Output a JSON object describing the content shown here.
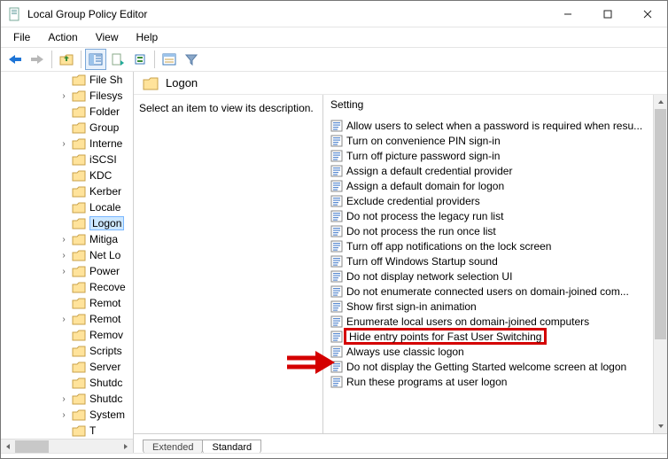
{
  "window": {
    "title": "Local Group Policy Editor"
  },
  "menu": {
    "file": "File",
    "action": "Action",
    "view": "View",
    "help": "Help"
  },
  "tree": {
    "items": [
      {
        "label": "File Sh",
        "expander": ""
      },
      {
        "label": "Filesys",
        "expander": "›"
      },
      {
        "label": "Folder",
        "expander": ""
      },
      {
        "label": "Group",
        "expander": ""
      },
      {
        "label": "Interne",
        "expander": "›"
      },
      {
        "label": "iSCSI",
        "expander": ""
      },
      {
        "label": "KDC",
        "expander": ""
      },
      {
        "label": "Kerber",
        "expander": ""
      },
      {
        "label": "Locale",
        "expander": ""
      },
      {
        "label": "Logon",
        "expander": "",
        "selected": true
      },
      {
        "label": "Mitiga",
        "expander": "›"
      },
      {
        "label": "Net Lo",
        "expander": "›"
      },
      {
        "label": "Power",
        "expander": "›"
      },
      {
        "label": "Recove",
        "expander": ""
      },
      {
        "label": "Remot",
        "expander": ""
      },
      {
        "label": "Remot",
        "expander": "›"
      },
      {
        "label": "Remov",
        "expander": ""
      },
      {
        "label": "Scripts",
        "expander": ""
      },
      {
        "label": "Server",
        "expander": ""
      },
      {
        "label": "Shutdc",
        "expander": ""
      },
      {
        "label": "Shutdc",
        "expander": "›"
      },
      {
        "label": "System",
        "expander": "›"
      },
      {
        "label": "T",
        "expander": ""
      }
    ]
  },
  "header": {
    "label": "Logon"
  },
  "description": {
    "prompt": "Select an item to view its description."
  },
  "list": {
    "column": "Setting",
    "items": [
      "Allow users to select when a password is required when resu...",
      "Turn on convenience PIN sign-in",
      "Turn off picture password sign-in",
      "Assign a default credential provider",
      "Assign a default domain for logon",
      "Exclude credential providers",
      "Do not process the legacy run list",
      "Do not process the run once list",
      "Turn off app notifications on the lock screen",
      "Turn off Windows Startup sound",
      "Do not display network selection UI",
      "Do not enumerate connected users on domain-joined com...",
      "Show first sign-in animation",
      "Enumerate local users on domain-joined computers",
      "Hide entry points for Fast User Switching",
      "Always use classic logon",
      "Do not display the Getting Started welcome screen at logon",
      "Run these programs at user logon"
    ],
    "highlight_index": 14
  },
  "tabs": {
    "extended": "Extended",
    "standard": "Standard"
  }
}
